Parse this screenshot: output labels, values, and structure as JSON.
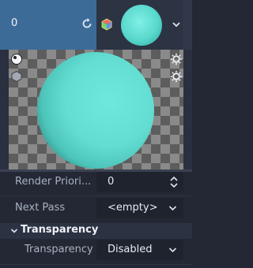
{
  "resource": {
    "value": "0"
  },
  "properties": {
    "render_priority": {
      "label": "Render Priori...",
      "value": "0"
    },
    "next_pass": {
      "label": "Next Pass",
      "value": "<empty>"
    }
  },
  "section": {
    "title": "Transparency"
  },
  "transparency": {
    "label": "Transparency",
    "value": "Disabled"
  },
  "colors": {
    "sphere": "#5fdcd1",
    "accent": "#3c6b98"
  }
}
